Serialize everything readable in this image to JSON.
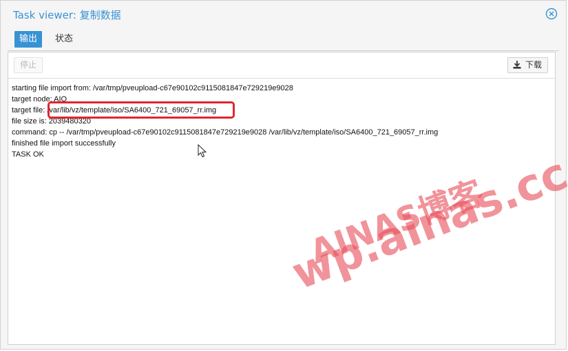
{
  "window": {
    "title_prefix": "Task viewer: ",
    "title_task": "复制数据"
  },
  "tabs": [
    {
      "label": "输出",
      "active": true
    },
    {
      "label": "状态",
      "active": false
    }
  ],
  "toolbar": {
    "stop_label": "停止",
    "download_label": "下载"
  },
  "log": {
    "lines": [
      "starting file import from: /var/tmp/pveupload-c67e90102c9115081847e729219e9028",
      "target node: AIO",
      "target file: /var/lib/vz/template/iso/SA6400_721_69057_rr.img",
      "file size is: 2039480320",
      "command: cp -- /var/tmp/pveupload-c67e90102c9115081847e729219e9028 /var/lib/vz/template/iso/SA6400_721_69057_rr.img",
      "finished file import successfully",
      "TASK OK"
    ]
  },
  "watermark": {
    "line1": "AINAS博客",
    "line2": "wp.ainas.cc"
  },
  "colors": {
    "accent": "#3892d4",
    "highlight": "#e0262e",
    "watermark": "#e8505c"
  },
  "icons": {
    "close": "close-circle-icon",
    "download": "download-icon",
    "cursor": "mouse-pointer-icon"
  }
}
